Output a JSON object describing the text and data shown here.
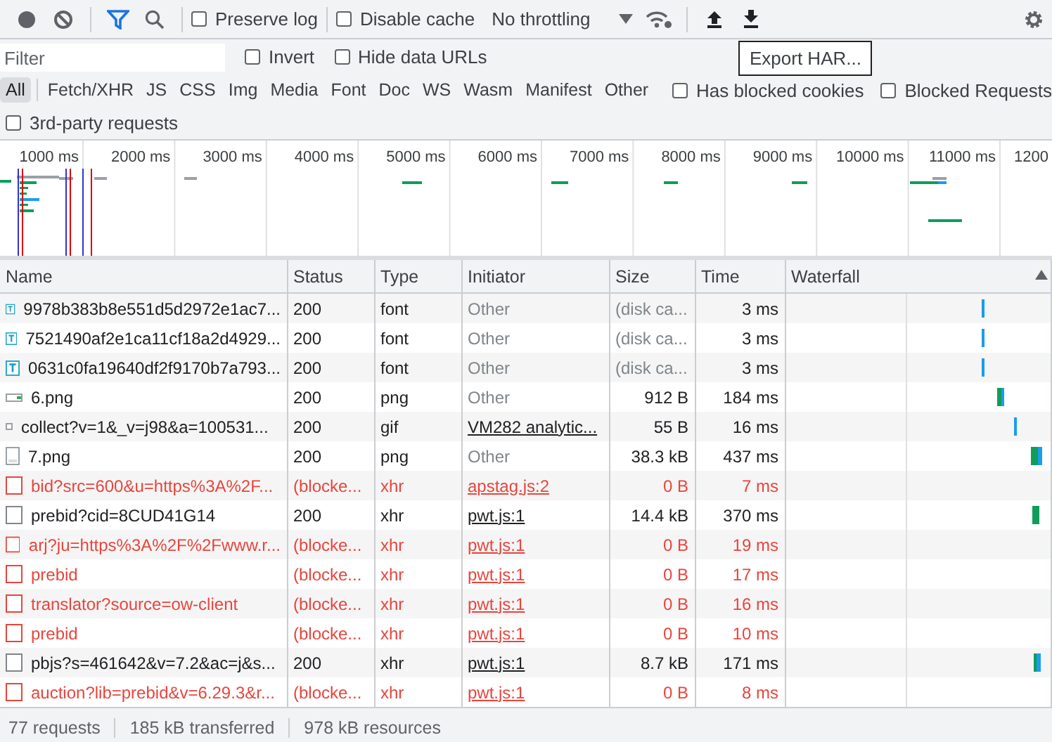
{
  "toolbar": {
    "preserve_log": {
      "label": "Preserve log",
      "checked": false
    },
    "disable_cache": {
      "label": "Disable cache",
      "checked": false
    },
    "throttling": "No throttling",
    "tooltip": "Export HAR..."
  },
  "filter": {
    "placeholder": "Filter",
    "invert": {
      "label": "Invert",
      "checked": false
    },
    "hide_data_urls": {
      "label": "Hide data URLs",
      "checked": false
    }
  },
  "type_filters": [
    {
      "label": "All",
      "selected": true
    },
    {
      "label": "Fetch/XHR",
      "selected": false
    },
    {
      "label": "JS",
      "selected": false
    },
    {
      "label": "CSS",
      "selected": false
    },
    {
      "label": "Img",
      "selected": false
    },
    {
      "label": "Media",
      "selected": false
    },
    {
      "label": "Font",
      "selected": false
    },
    {
      "label": "Doc",
      "selected": false
    },
    {
      "label": "WS",
      "selected": false
    },
    {
      "label": "Wasm",
      "selected": false
    },
    {
      "label": "Manifest",
      "selected": false
    },
    {
      "label": "Other",
      "selected": false
    }
  ],
  "extra_filters": [
    {
      "label": "Has blocked cookies",
      "checked": false
    },
    {
      "label": "Blocked Requests",
      "checked": false
    },
    {
      "label": "3rd-party requests",
      "checked": false
    }
  ],
  "overview": {
    "ticks": [
      "1000 ms",
      "2000 ms",
      "3000 ms",
      "4000 ms",
      "5000 ms",
      "6000 ms",
      "7000 ms",
      "8000 ms",
      "9000 ms",
      "10000 ms",
      "11000 ms",
      "1200"
    ]
  },
  "table": {
    "columns": [
      "Name",
      "Status",
      "Type",
      "Initiator",
      "Size",
      "Time",
      "Waterfall"
    ],
    "rows": [
      {
        "kind": "font",
        "name": "9978b383b8e551d5d2972e1ac7...",
        "status": "200",
        "type": "font",
        "initiator": "Other",
        "initiator_link": false,
        "size": "(disk ca...",
        "time": "3 ms",
        "blocked": false
      },
      {
        "kind": "font",
        "name": "7521490af2e1ca11cf18a2d4929...",
        "status": "200",
        "type": "font",
        "initiator": "Other",
        "initiator_link": false,
        "size": "(disk ca...",
        "time": "3 ms",
        "blocked": false
      },
      {
        "kind": "font",
        "name": "0631c0fa19640df2f9170b7a793...",
        "status": "200",
        "type": "font",
        "initiator": "Other",
        "initiator_link": false,
        "size": "(disk ca...",
        "time": "3 ms",
        "blocked": false
      },
      {
        "kind": "image",
        "name": "6.png",
        "status": "200",
        "type": "png",
        "initiator": "Other",
        "initiator_link": false,
        "size": "912 B",
        "time": "184 ms",
        "blocked": false
      },
      {
        "kind": "pixel",
        "name": "collect?v=1&_v=j98&a=100531...",
        "status": "200",
        "type": "gif",
        "initiator": "VM282 analytic...",
        "initiator_link": true,
        "size": "55 B",
        "time": "16 ms",
        "blocked": false
      },
      {
        "kind": "document",
        "name": "7.png",
        "status": "200",
        "type": "png",
        "initiator": "Other",
        "initiator_link": false,
        "size": "38.3 kB",
        "time": "437 ms",
        "blocked": false
      },
      {
        "kind": "xhr",
        "name": "bid?src=600&u=https%3A%2F...",
        "status": "(blocke...",
        "type": "xhr",
        "initiator": "apstag.js:2",
        "initiator_link": true,
        "size": "0 B",
        "time": "7 ms",
        "blocked": true
      },
      {
        "kind": "xhr",
        "name": "prebid?cid=8CUD41G14",
        "status": "200",
        "type": "xhr",
        "initiator": "pwt.js:1",
        "initiator_link": true,
        "size": "14.4 kB",
        "time": "370 ms",
        "blocked": false
      },
      {
        "kind": "xhr",
        "name": "arj?ju=https%3A%2F%2Fwww.r...",
        "status": "(blocke...",
        "type": "xhr",
        "initiator": "pwt.js:1",
        "initiator_link": true,
        "size": "0 B",
        "time": "19 ms",
        "blocked": true
      },
      {
        "kind": "xhr",
        "name": "prebid",
        "status": "(blocke...",
        "type": "xhr",
        "initiator": "pwt.js:1",
        "initiator_link": true,
        "size": "0 B",
        "time": "17 ms",
        "blocked": true
      },
      {
        "kind": "xhr",
        "name": "translator?source=ow-client",
        "status": "(blocke...",
        "type": "xhr",
        "initiator": "pwt.js:1",
        "initiator_link": true,
        "size": "0 B",
        "time": "16 ms",
        "blocked": true
      },
      {
        "kind": "xhr",
        "name": "prebid",
        "status": "(blocke...",
        "type": "xhr",
        "initiator": "pwt.js:1",
        "initiator_link": true,
        "size": "0 B",
        "time": "10 ms",
        "blocked": true
      },
      {
        "kind": "xhr",
        "name": "pbjs?s=461642&v=7.2&ac=j&s...",
        "status": "200",
        "type": "xhr",
        "initiator": "pwt.js:1",
        "initiator_link": true,
        "size": "8.7 kB",
        "time": "171 ms",
        "blocked": false
      },
      {
        "kind": "xhr",
        "name": "auction?lib=prebid&v=6.29.3&r...",
        "status": "(blocke...",
        "type": "xhr",
        "initiator": "pwt.js:1",
        "initiator_link": true,
        "size": "0 B",
        "time": "8 ms",
        "blocked": true
      }
    ]
  },
  "status_bar": [
    "77 requests",
    "185 kB transferred",
    "978 kB resources"
  ]
}
